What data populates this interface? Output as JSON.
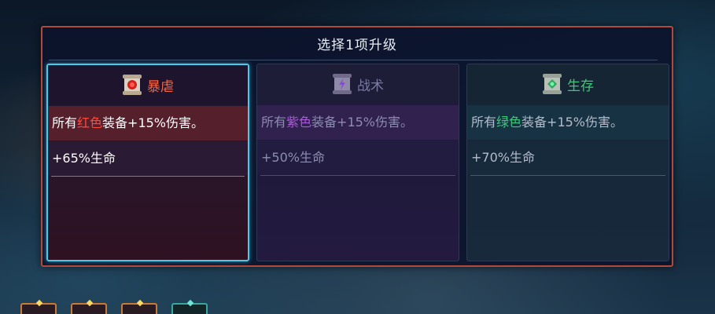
{
  "dialog": {
    "title": "选择1项升级"
  },
  "cards": [
    {
      "name": "暴虐",
      "icon": "red-scroll-icon",
      "accent": "#ee6a4a",
      "selected": true,
      "line1": {
        "prefix": "所有",
        "keyword": "红色",
        "suffix": "装备+15%伤害。"
      },
      "line2": "+65%生命"
    },
    {
      "name": "战术",
      "icon": "purple-scroll-icon",
      "accent": "#a85ad8",
      "selected": false,
      "line1": {
        "prefix": "所有",
        "keyword": "紫色",
        "suffix": "装备+15%伤害。"
      },
      "line2": "+50%生命"
    },
    {
      "name": "生存",
      "icon": "green-scroll-icon",
      "accent": "#3cc878",
      "selected": false,
      "line1": {
        "prefix": "所有",
        "keyword": "绿色",
        "suffix": "装备+15%伤害。"
      },
      "line2": "+70%生命"
    }
  ],
  "colors": {
    "panel_border": "#b04a3c",
    "selection_border": "#4cc8ea"
  },
  "bottom_bar": {
    "slots": [
      "equipment-slot-icon",
      "equipment-slot-icon",
      "equipment-slot-icon",
      "equipment-slot-icon"
    ]
  }
}
